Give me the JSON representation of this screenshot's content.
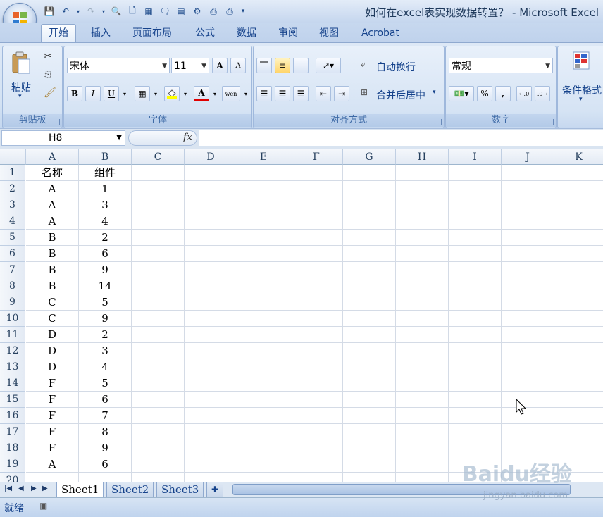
{
  "window": {
    "title": "如何在excel表实现数据转置？ - Microsoft Excel"
  },
  "tabs": [
    "开始",
    "插入",
    "页面布局",
    "公式",
    "数据",
    "审阅",
    "视图",
    "Acrobat"
  ],
  "ribbon": {
    "clipboard": {
      "label": "剪贴板",
      "paste": "粘贴"
    },
    "font": {
      "label": "字体",
      "name": "宋体",
      "size": "11",
      "grow": "A",
      "shrink": "A",
      "bold": "B",
      "italic": "I",
      "underline": "U",
      "font_color": "A",
      "phonetic": "wén"
    },
    "alignment": {
      "label": "对齐方式",
      "wrap": "自动换行",
      "merge": "合并后居中"
    },
    "number": {
      "label": "数字",
      "format": "常规",
      "percent": "%",
      "comma": ","
    },
    "styles": {
      "conditional": "条件格式"
    }
  },
  "formula_bar": {
    "name_box": "H8",
    "fx": "fx",
    "value": ""
  },
  "columns": [
    "A",
    "B",
    "C",
    "D",
    "E",
    "F",
    "G",
    "H",
    "I",
    "J",
    "K"
  ],
  "rows": [
    {
      "n": "1",
      "a": "名称",
      "b": "组件"
    },
    {
      "n": "2",
      "a": "A",
      "b": "1"
    },
    {
      "n": "3",
      "a": "A",
      "b": "3"
    },
    {
      "n": "4",
      "a": "A",
      "b": "4"
    },
    {
      "n": "5",
      "a": "B",
      "b": "2"
    },
    {
      "n": "6",
      "a": "B",
      "b": "6"
    },
    {
      "n": "7",
      "a": "B",
      "b": "9"
    },
    {
      "n": "8",
      "a": "B",
      "b": "14"
    },
    {
      "n": "9",
      "a": "C",
      "b": "5"
    },
    {
      "n": "10",
      "a": "C",
      "b": "9"
    },
    {
      "n": "11",
      "a": "D",
      "b": "2"
    },
    {
      "n": "12",
      "a": "D",
      "b": "3"
    },
    {
      "n": "13",
      "a": "D",
      "b": "4"
    },
    {
      "n": "14",
      "a": "F",
      "b": "5"
    },
    {
      "n": "15",
      "a": "F",
      "b": "6"
    },
    {
      "n": "16",
      "a": "F",
      "b": "7"
    },
    {
      "n": "17",
      "a": "F",
      "b": "8"
    },
    {
      "n": "18",
      "a": "F",
      "b": "9"
    },
    {
      "n": "19",
      "a": "A",
      "b": "6"
    },
    {
      "n": "20",
      "a": "",
      "b": ""
    }
  ],
  "sheets": [
    "Sheet1",
    "Sheet2",
    "Sheet3"
  ],
  "status": {
    "ready": "就绪"
  },
  "watermark": {
    "brand": "Baidu经验",
    "url": "jingyan.baidu.com"
  }
}
